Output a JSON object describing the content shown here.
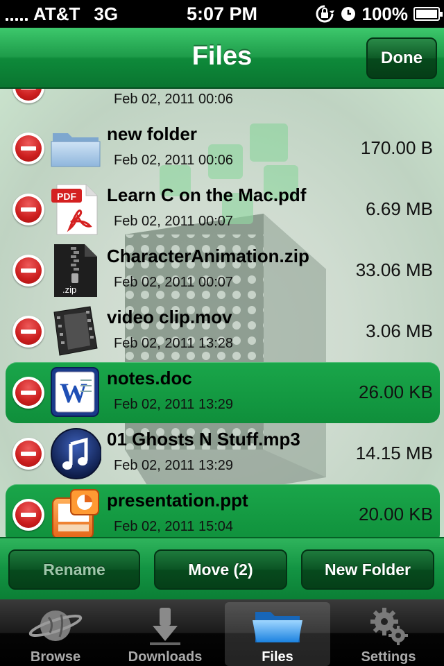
{
  "status_bar": {
    "carrier": "AT&T",
    "network": "3G",
    "time": "5:07 PM",
    "battery": "100%",
    "battery_level": 1.0
  },
  "nav_bar": {
    "title": "Files",
    "done_label": "Done"
  },
  "files": [
    {
      "name": "",
      "date": "Feb 02, 2011 00:06",
      "size": "",
      "icon": "pictures-icon",
      "selected": false
    },
    {
      "name": "new folder",
      "date": "Feb 02, 2011 00:06",
      "size": "170.00 B",
      "icon": "folder-icon",
      "selected": false
    },
    {
      "name": "Learn C on the Mac.pdf",
      "date": "Feb 02, 2011 00:07",
      "size": "6.69 MB",
      "icon": "pdf-file-icon",
      "badge": "PDF",
      "selected": false
    },
    {
      "name": "CharacterAnimation.zip",
      "date": "Feb 02, 2011 00:07",
      "size": "33.06 MB",
      "icon": "zip-file-icon",
      "badge": ".zip",
      "selected": false
    },
    {
      "name": "video clip.mov",
      "date": "Feb 02, 2011 13:28",
      "size": "3.06 MB",
      "icon": "video-file-icon",
      "selected": false
    },
    {
      "name": "notes.doc",
      "date": "Feb 02, 2011 13:29",
      "size": "26.00 KB",
      "icon": "word-doc-icon",
      "badge": "W",
      "selected": true
    },
    {
      "name": "01 Ghosts N Stuff.mp3",
      "date": "Feb 02, 2011 13:29",
      "size": "14.15 MB",
      "icon": "music-file-icon",
      "selected": false
    },
    {
      "name": "presentation.ppt",
      "date": "Feb 02, 2011 15:04",
      "size": "20.00 KB",
      "icon": "powerpoint-icon",
      "selected": true
    }
  ],
  "toolbar": {
    "rename_label": "Rename",
    "move_label": "Move (2)",
    "new_folder_label": "New Folder"
  },
  "tab_bar": {
    "tabs": [
      {
        "label": "Browse",
        "icon": "globe-icon",
        "active": false
      },
      {
        "label": "Downloads",
        "icon": "download-arrow-icon",
        "active": false
      },
      {
        "label": "Files",
        "icon": "folder-icon",
        "active": true
      },
      {
        "label": "Settings",
        "icon": "gear-icon",
        "active": false
      }
    ]
  },
  "colors": {
    "nav_green": "#1e9c4a",
    "selection_green": "#0f8f3b",
    "delete_red": "#cc1f1f"
  }
}
